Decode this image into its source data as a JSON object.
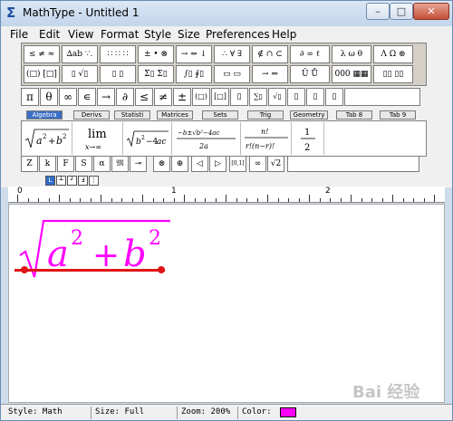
{
  "window": {
    "title": "MathType - Untitled 1",
    "controls": {
      "minimize": "–",
      "maximize": "□",
      "close": "✕"
    }
  },
  "menu": [
    "File",
    "Edit",
    "View",
    "Format",
    "Style",
    "Size",
    "Preferences",
    "Help"
  ],
  "symbol_row1": [
    "≤ ≠ ≈",
    "∆ab ∵.",
    "∷ ∷ ∷",
    "± • ⊗",
    "→ ⇔ ↓",
    "∴ ∀ ∃",
    "∉ ∩ ⊂",
    "∂ ∞ ℓ",
    "λ ω θ",
    "Λ Ω ⊛"
  ],
  "symbol_row2": [
    "(□) [□]",
    "▯ √▯",
    "▯ ▯",
    "Σ▯ Σ▯",
    "∫▯ ∮▯",
    "▭ ▭",
    "→ ⇐",
    "Ū Ů",
    "000 ▦▦",
    "▯▯ ▯▯"
  ],
  "quick_row": [
    "π",
    "θ",
    "∞",
    "∊",
    "→",
    "∂",
    "≤",
    "≠",
    "±",
    "(□)",
    "[□]",
    "▯",
    "∑▯",
    "√▯",
    "▯",
    "▯",
    "▯"
  ],
  "tabs": [
    "Algebra",
    "Derivs",
    "Statisti",
    "Matrices",
    "Sets",
    "Trig",
    "Geometry",
    "Tab 8",
    "Tab 9"
  ],
  "templates": [
    "√(a²+b²)",
    "lim x→∞",
    "√(b²−4ac)",
    "(−b±√(b²−4ac))/2a",
    "n!/(r!(n−r)!)",
    "1/2"
  ],
  "style_row": [
    "Z",
    "k",
    "F",
    "S",
    "α",
    "𝔐",
    "⊸",
    "⊗",
    "⊕",
    "◁",
    "▷",
    "[0,1]",
    "∞",
    "√2"
  ],
  "tab_stops": [
    "L",
    "┴",
    "┘",
    "Ⅎ",
    "⋮"
  ],
  "ruler": {
    "marks": [
      "0",
      "1",
      "2"
    ]
  },
  "equation": {
    "base": "a",
    "exp1": "2",
    "op": "+",
    "base2": "b",
    "exp2": "2",
    "color": "#ff00ff"
  },
  "status": {
    "style": "Style: Math",
    "size": "Size: Full",
    "zoom": "Zoom: 200%",
    "color_label": "Color:",
    "color_value": "#ff00ff"
  },
  "watermark": "Bai 经验"
}
